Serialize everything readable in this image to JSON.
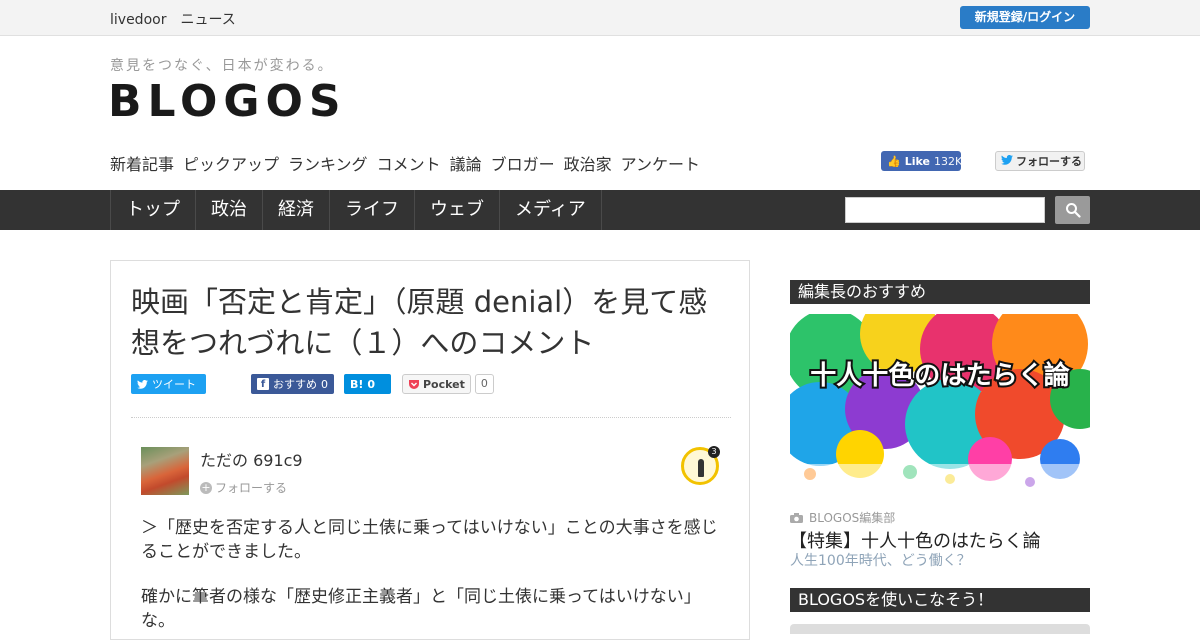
{
  "topbar": {
    "brand": "livedoor　ニュース",
    "login": "新規登録/ログイン"
  },
  "header": {
    "tagline": "意見をつなぐ、日本が変わる。",
    "logo": "BLOGOS",
    "subnav": [
      "新着記事",
      "ピックアップ",
      "ランキング",
      "コメント",
      "議論",
      "ブロガー",
      "政治家",
      "アンケート"
    ],
    "fb_like": {
      "label": "Like",
      "count": "132K"
    },
    "twitter_follow": "フォローする"
  },
  "mainnav": [
    "トップ",
    "政治",
    "経済",
    "ライフ",
    "ウェブ",
    "メディア"
  ],
  "article": {
    "title": "映画「否定と肯定」（原題 denial）を見て感想をつれづれに（１）へのコメント",
    "share": {
      "tweet": "ツイート",
      "fb_label": "おすすめ",
      "fb_count": "0",
      "hatena_label": "B!",
      "hatena_count": "0",
      "pocket_label": "Pocket",
      "pocket_count": "0"
    },
    "comment": {
      "user": "ただの 691c9",
      "follow": "フォローする",
      "badge_count": "3",
      "paragraphs": [
        "＞「歴史を否定する人と同じ土俵に乗ってはいけない」ことの大事さを感じることができました。",
        "確かに筆者の様な「歴史修正主義者」と「同じ土俵に乗ってはいけない」な。"
      ]
    }
  },
  "sidebar": {
    "head1": "編集長のおすすめ",
    "feature": {
      "image_text": "十人十色のはたらく論",
      "source": "BLOGOS編集部",
      "title": "【特集】十人十色のはたらく論",
      "subtitle": "人生100年時代、どう働く？"
    },
    "head2": "BLOGOSを使いこなそう！"
  },
  "colors": {
    "accent": "#2a7cc7",
    "nav_bg": "#333333",
    "facebook": "#3b5998",
    "twitter": "#1da1f2"
  }
}
